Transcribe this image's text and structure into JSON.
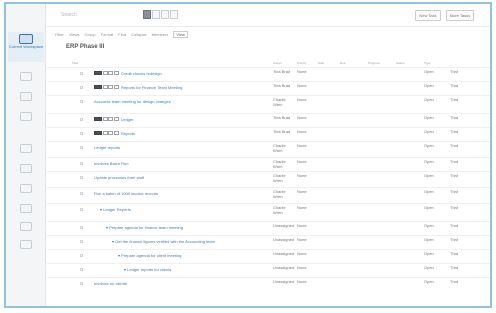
{
  "sidebar": {
    "items": [
      {
        "label": "Current Workspace",
        "icon": "projects-icon"
      },
      {
        "label": "",
        "icon": "home-icon"
      },
      {
        "label": "",
        "icon": "inbox-icon"
      },
      {
        "label": "",
        "icon": "people-icon"
      },
      {
        "label": "",
        "icon": "reports-icon"
      },
      {
        "label": "",
        "icon": "calendar-icon"
      },
      {
        "label": "",
        "icon": "docs-icon"
      },
      {
        "label": "",
        "icon": "team-icon"
      },
      {
        "label": "",
        "icon": "time-icon"
      },
      {
        "label": "",
        "icon": "user-icon"
      }
    ]
  },
  "toolbar": {
    "search_placeholder": "Search",
    "new_task_label": "New Task",
    "more_tasks_label": "More Tasks"
  },
  "subbar": [
    "Filter",
    "Views",
    "Group",
    "Format",
    "Find",
    "Collapse",
    "Members"
  ],
  "subbar_badge": "View",
  "project": {
    "title": "ERP Phase III"
  },
  "columns": [
    "Task",
    "Owner",
    "Priority",
    "Start",
    "Due",
    "Progress",
    "Status",
    "Type"
  ],
  "rows": [
    {
      "task": "Credit checks redesign",
      "tags": true,
      "indent": 0,
      "owner": "Tina Brad",
      "priority": "None",
      "status": "Open",
      "type": "Thrd"
    },
    {
      "task": "Reports for Finance Team Meeting",
      "tags": true,
      "indent": 0,
      "owner": "Tina Brad",
      "priority": "None",
      "status": "Open",
      "type": "Thrd"
    },
    {
      "task": "Accounts team meeting for design changes",
      "tags": false,
      "indent": 0,
      "owner": "Charlie Wren",
      "priority": "None",
      "status": "Open",
      "type": "Thrd"
    },
    {
      "task": "Ledger",
      "tags": true,
      "indent": 0,
      "owner": "Tina Brad",
      "priority": "None",
      "status": "Open",
      "type": "Thrd"
    },
    {
      "task": "Reports",
      "tags": true,
      "indent": 0,
      "owner": "Tina Brad",
      "priority": "None",
      "status": "Open",
      "type": "Thrd"
    },
    {
      "task": "Ledger reports",
      "tags": false,
      "indent": 0,
      "owner": "Charlie Wren",
      "priority": "None",
      "status": "Open",
      "type": "Thrd"
    },
    {
      "task": "Invoices Batch Run",
      "tags": false,
      "indent": 0,
      "owner": "Charlie Wren",
      "priority": "None",
      "status": "Open",
      "type": "Thrd"
    },
    {
      "task": "Update processes from staff",
      "tags": false,
      "indent": 0,
      "owner": "Charlie Wren",
      "priority": "None",
      "status": "Open",
      "type": "Thrd"
    },
    {
      "task": "Run a batch of 1000 invoice records",
      "tags": false,
      "indent": 0,
      "owner": "Charlie Wren",
      "priority": "None",
      "status": "Open",
      "type": "Thrd"
    },
    {
      "task": "Ledger Reports",
      "tags": false,
      "indent": 1,
      "owner": "Charlie Wren",
      "priority": "None",
      "status": "Open",
      "type": "Thrd"
    },
    {
      "task": "Prepare agenda for finance team meeting",
      "tags": false,
      "indent": 2,
      "owner": "Unassigned",
      "priority": "None",
      "status": "Open",
      "type": "Thrd"
    },
    {
      "task": "Get the finance figures verified with the Accounting team",
      "tags": false,
      "indent": 3,
      "owner": "Unassigned",
      "priority": "None",
      "status": "Open",
      "type": "Thrd"
    },
    {
      "task": "Prepare agenda for client meeting",
      "tags": false,
      "indent": 4,
      "owner": "Unassigned",
      "priority": "None",
      "status": "Open",
      "type": "Thrd"
    },
    {
      "task": "Ledger reports for clients",
      "tags": false,
      "indent": 5,
      "owner": "Unassigned",
      "priority": "None",
      "status": "Open",
      "type": "Thrd"
    },
    {
      "task": "Invoices for clients",
      "tags": false,
      "indent": 0,
      "owner": "Unassigned",
      "priority": "None",
      "status": "Open",
      "type": "Thrd"
    }
  ],
  "colors": {
    "accent": "#3f7db8",
    "frame": "#8fc3de",
    "sidebar_bg": "#f4f5f6"
  }
}
